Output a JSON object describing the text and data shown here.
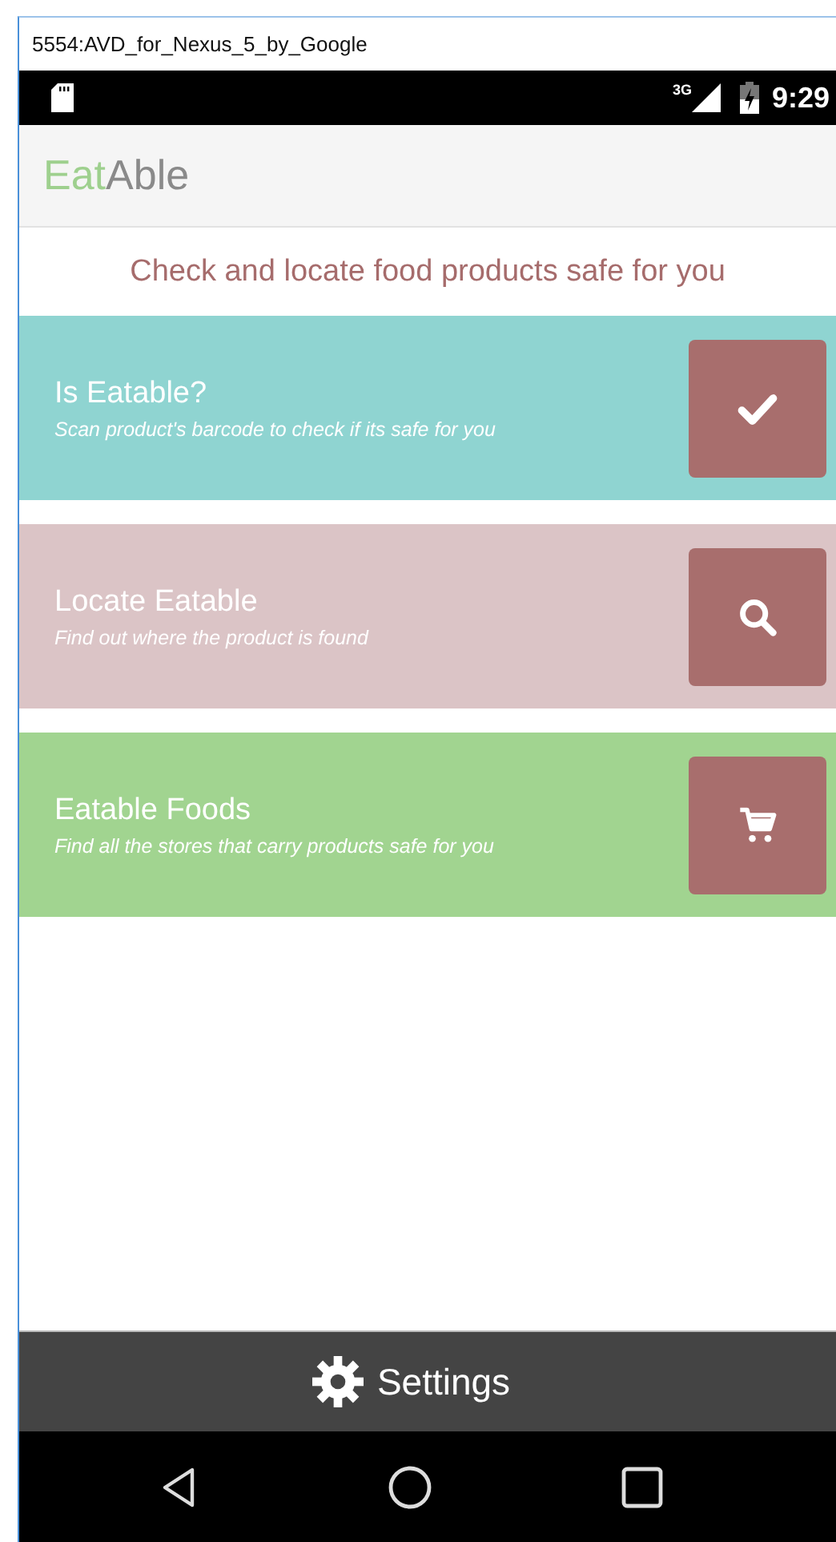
{
  "window": {
    "title": "5554:AVD_for_Nexus_5_by_Google"
  },
  "status_bar": {
    "time": "9:29",
    "network": "3G"
  },
  "app_bar": {
    "title_lead": "Eat",
    "title_rest": "Able"
  },
  "tagline": "Check and locate food products safe for you",
  "cards": [
    {
      "title": "Is Eatable?",
      "subtitle": "Scan product's barcode to check if its safe for you",
      "color": "#8fd4d1",
      "kind": "check"
    },
    {
      "title": "Locate Eatable",
      "subtitle": "Find out where the product is found",
      "color": "#dbc4c6",
      "kind": "search"
    },
    {
      "title": "Eatable Foods",
      "subtitle": "Find all the stores that carry products safe for you",
      "color": "#a1d490",
      "kind": "cart"
    }
  ],
  "bottom_bar": {
    "label": "Settings"
  }
}
